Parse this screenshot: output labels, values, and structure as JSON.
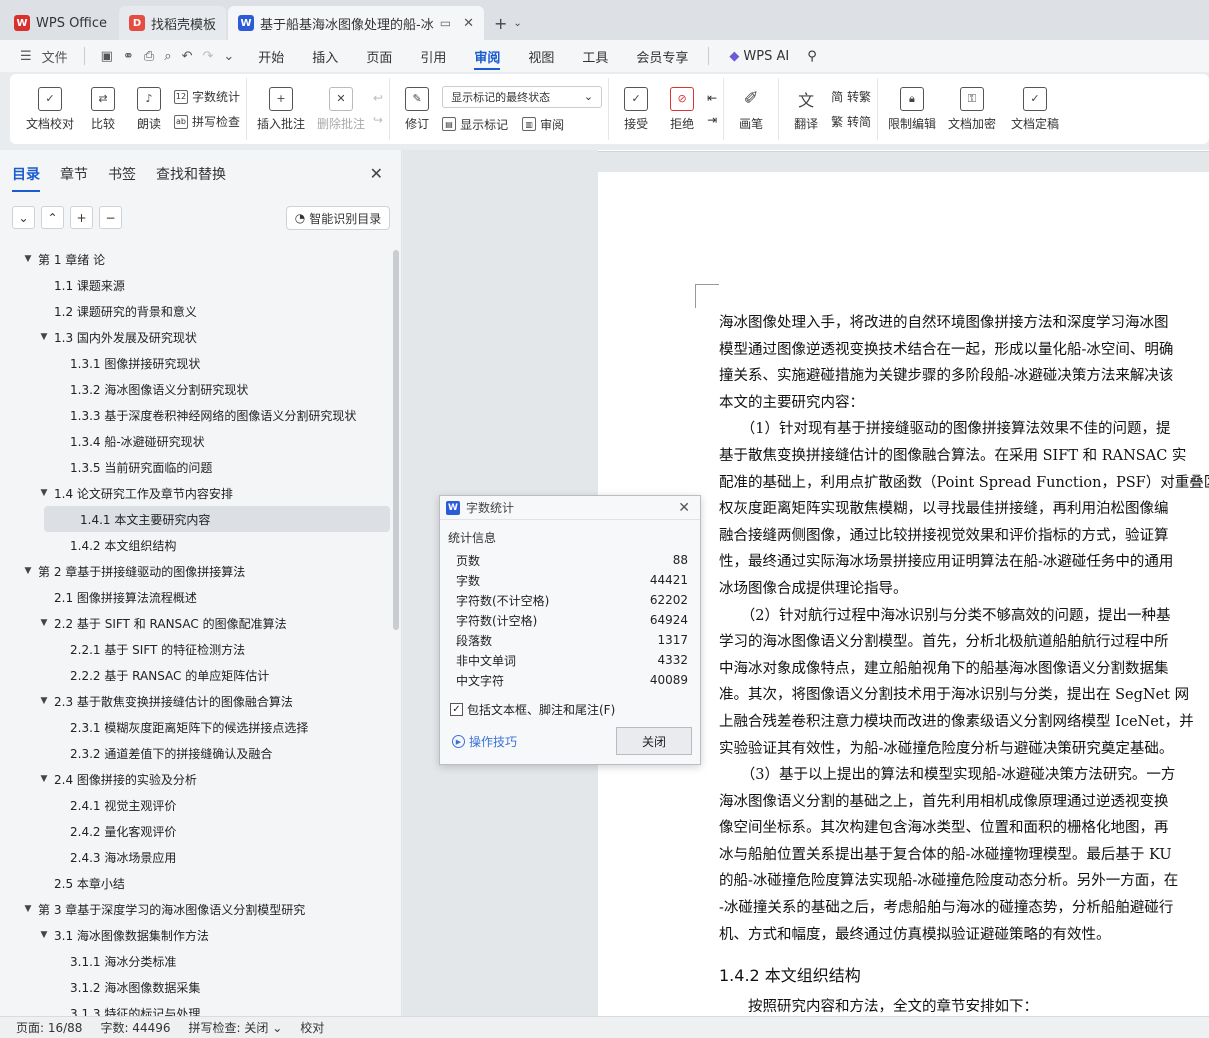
{
  "tabs": [
    {
      "label": "WPS Office",
      "badge": "W",
      "color": "#d9302e"
    },
    {
      "label": "找稻壳模板",
      "badge": "D",
      "color": "#e54d42"
    },
    {
      "label": "基于船基海冰图像处理的船-冰",
      "badge": "W",
      "color": "#2d5bd7",
      "active": true
    }
  ],
  "tab_plus": "+",
  "menu": {
    "file": "文件",
    "items": [
      "开始",
      "插入",
      "页面",
      "引用",
      "审阅",
      "视图",
      "工具",
      "会员专享"
    ],
    "active": "审阅",
    "wps_ai": "WPS AI"
  },
  "ribbon": {
    "doc_check": "文档校对",
    "compare": "比较",
    "read": "朗读",
    "word_count": "字数统计",
    "spell_check": "拼写检查",
    "insert_comment": "插入批注",
    "delete_comment": "删除批注",
    "revise": "修订",
    "markup_state": "显示标记的最终状态",
    "show_markup": "显示标记",
    "review": "审阅",
    "accept": "接受",
    "reject": "拒绝",
    "pen": "画笔",
    "translate": "翻译",
    "trad": "简 转繁",
    "simp": "繁 转简",
    "restrict": "限制编辑",
    "encrypt": "文档加密",
    "finalize": "文档定稿"
  },
  "panel": {
    "tabs": [
      "目录",
      "章节",
      "书签",
      "查找和替换"
    ],
    "active_tab": "目录",
    "smart_toc": "智能识别目录",
    "toc": [
      {
        "level": 0,
        "arrow": true,
        "text": "第 1 章绪   论"
      },
      {
        "level": 1,
        "arrow": false,
        "text": "1.1  课题来源"
      },
      {
        "level": 1,
        "arrow": false,
        "text": "1.2  课题研究的背景和意义"
      },
      {
        "level": 1,
        "arrow": true,
        "text": "1.3  国内外发展及研究现状"
      },
      {
        "level": 2,
        "arrow": false,
        "text": "1.3.1  图像拼接研究现状"
      },
      {
        "level": 2,
        "arrow": false,
        "text": "1.3.2  海冰图像语义分割研究现状"
      },
      {
        "level": 2,
        "arrow": false,
        "text": "1.3.3  基于深度卷积神经网络的图像语义分割研究现状"
      },
      {
        "level": 2,
        "arrow": false,
        "text": "1.3.4  船-冰避碰研究现状"
      },
      {
        "level": 2,
        "arrow": false,
        "text": "1.3.5  当前研究面临的问题"
      },
      {
        "level": 1,
        "arrow": true,
        "text": "1.4  论文研究工作及章节内容安排"
      },
      {
        "level": 2,
        "arrow": false,
        "text": "1.4.1  本文主要研究内容",
        "selected": true
      },
      {
        "level": 2,
        "arrow": false,
        "text": "1.4.2  本文组织结构"
      },
      {
        "level": 0,
        "arrow": true,
        "text": "第 2 章基于拼接缝驱动的图像拼接算法"
      },
      {
        "level": 1,
        "arrow": false,
        "text": "2.1  图像拼接算法流程概述"
      },
      {
        "level": 1,
        "arrow": true,
        "text": "2.2  基于 SIFT 和 RANSAC 的图像配准算法"
      },
      {
        "level": 2,
        "arrow": false,
        "text": "2.2.1  基于 SIFT 的特征检测方法"
      },
      {
        "level": 2,
        "arrow": false,
        "text": "2.2.2  基于 RANSAC 的单应矩阵估计"
      },
      {
        "level": 1,
        "arrow": true,
        "text": "2.3  基于散焦变换拼接缝估计的图像融合算法"
      },
      {
        "level": 2,
        "arrow": false,
        "text": "2.3.1  模糊灰度距离矩阵下的候选拼接点选择"
      },
      {
        "level": 2,
        "arrow": false,
        "text": "2.3.2  通道差值下的拼接缝确认及融合"
      },
      {
        "level": 1,
        "arrow": true,
        "text": "2.4  图像拼接的实验及分析"
      },
      {
        "level": 2,
        "arrow": false,
        "text": "2.4.1  视觉主观评价"
      },
      {
        "level": 2,
        "arrow": false,
        "text": "2.4.2  量化客观评价"
      },
      {
        "level": 2,
        "arrow": false,
        "text": "2.4.3  海冰场景应用"
      },
      {
        "level": 1,
        "arrow": false,
        "text": "2.5  本章小结"
      },
      {
        "level": 0,
        "arrow": true,
        "text": "第 3 章基于深度学习的海冰图像语义分割模型研究"
      },
      {
        "level": 1,
        "arrow": true,
        "text": "3.1  海冰图像数据集制作方法"
      },
      {
        "level": 2,
        "arrow": false,
        "text": "3.1.1  海冰分类标准"
      },
      {
        "level": 2,
        "arrow": false,
        "text": "3.1.2  海冰图像数据采集"
      },
      {
        "level": 2,
        "arrow": false,
        "text": "3.1.3  特征的标记与处理"
      }
    ]
  },
  "document": {
    "lines": [
      "海冰图像处理入手，将改进的自然环境图像拼接方法和深度学习海冰图",
      "模型通过图像逆透视变换技术结合在一起，形成以量化船-冰空间、明确",
      "撞关系、实施避碰措施为关键步骤的多阶段船-冰避碰决策方法来解决该",
      "本文的主要研究内容：",
      "　　（1）针对现有基于拼接缝驱动的图像拼接算法效果不佳的问题，提",
      "基于散焦变换拼接缝估计的图像融合算法。在采用 SIFT 和 RANSAC 实",
      "配准的基础上，利用点扩散函数（Point Spread Function，PSF）对重叠区",
      "权灰度距离矩阵实现散焦模糊，以寻找最佳拼接缝，再利用泊松图像编",
      "融合接缝两侧图像，通过比较拼接视觉效果和评价指标的方式，验证算",
      "性，最终通过实际海冰场景拼接应用证明算法在船-冰避碰任务中的通用",
      "冰场图像合成提供理论指导。",
      "　　（2）针对航行过程中海冰识别与分类不够高效的问题，提出一种基",
      "学习的海冰图像语义分割模型。首先，分析北极航道船舶航行过程中所",
      "中海冰对象成像特点，建立船舶视角下的船基海冰图像语义分割数据集",
      "准。其次，将图像语义分割技术用于海冰识别与分类，提出在 SegNet 网",
      "上融合残差卷积注意力模块而改进的像素级语义分割网络模型 IceNet，并",
      "实验验证其有效性，为船-冰碰撞危险度分析与避碰决策研究奠定基础。",
      "　　（3）基于以上提出的算法和模型实现船-冰避碰决策方法研究。一方",
      "海冰图像语义分割的基础之上，首先利用相机成像原理通过逆透视变换",
      "像空间坐标系。其次构建包含海冰类型、位置和面积的栅格化地图，再",
      "冰与船舶位置关系提出基于复合体的船-冰碰撞物理模型。最后基于 KU",
      "的船-冰碰撞危险度算法实现船-冰碰撞危险度动态分析。另外一方面，在",
      "-冰碰撞关系的基础之后，考虑船舶与海冰的碰撞态势，分析船舶避碰行",
      "机、方式和幅度，最终通过仿真模拟验证避碰策略的有效性。"
    ],
    "heading": "1.4.2  本文组织结构",
    "next_line": "　　按照研究内容和方法，全文的章节安排如下："
  },
  "dialog": {
    "title": "字数统计",
    "section": "统计信息",
    "stats": [
      {
        "label": "页数",
        "value": "88"
      },
      {
        "label": "字数",
        "value": "44421"
      },
      {
        "label": "字符数(不计空格)",
        "value": "62202"
      },
      {
        "label": "字符数(计空格)",
        "value": "64924"
      },
      {
        "label": "段落数",
        "value": "1317"
      },
      {
        "label": "非中文单词",
        "value": "4332"
      },
      {
        "label": "中文字符",
        "value": "40089"
      }
    ],
    "checkbox": "包括文本框、脚注和尾注(F)",
    "tips": "操作技巧",
    "close": "关闭"
  },
  "status": {
    "page": "页面: 16/88",
    "words": "字数: 44496",
    "spell": "拼写检查: 关闭",
    "proof": "校对"
  }
}
